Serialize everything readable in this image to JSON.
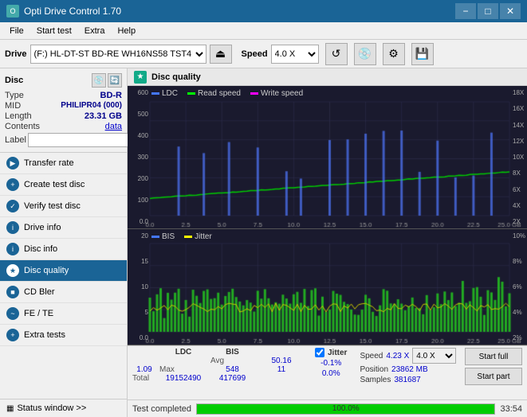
{
  "titleBar": {
    "title": "Opti Drive Control 1.70",
    "minimizeLabel": "−",
    "maximizeLabel": "□",
    "closeLabel": "✕"
  },
  "menuBar": {
    "items": [
      "File",
      "Start test",
      "Extra",
      "Help"
    ]
  },
  "driveBar": {
    "driveLabel": "Drive",
    "driveValue": "(F:) HL-DT-ST BD-RE  WH16NS58 TST4",
    "speedLabel": "Speed",
    "speedValue": "4.0 X"
  },
  "disc": {
    "title": "Disc",
    "typeLabel": "Type",
    "typeValue": "BD-R",
    "midLabel": "MID",
    "midValue": "PHILIPR04 (000)",
    "lengthLabel": "Length",
    "lengthValue": "23.31 GB",
    "contentsLabel": "Contents",
    "contentsValue": "data",
    "labelLabel": "Label"
  },
  "navItems": [
    {
      "id": "transfer-rate",
      "label": "Transfer rate"
    },
    {
      "id": "create-test-disc",
      "label": "Create test disc"
    },
    {
      "id": "verify-test-disc",
      "label": "Verify test disc"
    },
    {
      "id": "drive-info",
      "label": "Drive info"
    },
    {
      "id": "disc-info",
      "label": "Disc info"
    },
    {
      "id": "disc-quality",
      "label": "Disc quality",
      "active": true
    },
    {
      "id": "cd-bler",
      "label": "CD Bler"
    },
    {
      "id": "fe-te",
      "label": "FE / TE"
    },
    {
      "id": "extra-tests",
      "label": "Extra tests"
    }
  ],
  "statusWindow": {
    "label": "Status window >>"
  },
  "discQuality": {
    "title": "Disc quality"
  },
  "chart1": {
    "legendItems": [
      {
        "label": "LDC",
        "color": "#0080ff"
      },
      {
        "label": "Read speed",
        "color": "#00ff00"
      },
      {
        "label": "Write speed",
        "color": "#ff00ff"
      }
    ],
    "yLeftLabels": [
      "600",
      "500",
      "400",
      "300",
      "200",
      "100",
      "0.0"
    ],
    "yRightLabels": [
      "18X",
      "16X",
      "14X",
      "12X",
      "10X",
      "8X",
      "6X",
      "4X",
      "2X"
    ],
    "xLabels": [
      "0.0",
      "2.5",
      "5.0",
      "7.5",
      "10.0",
      "12.5",
      "15.0",
      "17.5",
      "20.0",
      "22.5",
      "25.0 GB"
    ]
  },
  "chart2": {
    "legendItems": [
      {
        "label": "BIS",
        "color": "#0080ff"
      },
      {
        "label": "Jitter",
        "color": "#ffff00"
      }
    ],
    "yLeftLabels": [
      "20",
      "15",
      "10",
      "5",
      "0.0"
    ],
    "yRightLabels": [
      "10%",
      "8%",
      "6%",
      "4%",
      "2%"
    ],
    "xLabels": [
      "0.0",
      "2.5",
      "5.0",
      "7.5",
      "10.0",
      "12.5",
      "15.0",
      "17.5",
      "20.0",
      "22.5",
      "25.0 GB"
    ]
  },
  "stats": {
    "columns": [
      "LDC",
      "BIS",
      "Jitter"
    ],
    "rows": [
      {
        "key": "Avg",
        "ldc": "50.16",
        "bis": "1.09",
        "jitter": "-0.1%"
      },
      {
        "key": "Max",
        "ldc": "548",
        "bis": "11",
        "jitter": "0.0%"
      },
      {
        "key": "Total",
        "ldc": "19152490",
        "bis": "417699",
        "jitter": ""
      }
    ],
    "jitterChecked": true,
    "jitterLabel": "Jitter",
    "speedLabel": "Speed",
    "speedValue": "4.23 X",
    "speedSelect": "4.0 X",
    "positionLabel": "Position",
    "positionValue": "23862 MB",
    "samplesLabel": "Samples",
    "samplesValue": "381687",
    "startFullBtn": "Start full",
    "startPartBtn": "Start part"
  },
  "progressBar": {
    "statusText": "Test completed",
    "fillPercent": 100,
    "percentText": "100.0%",
    "timeText": "33:54"
  }
}
